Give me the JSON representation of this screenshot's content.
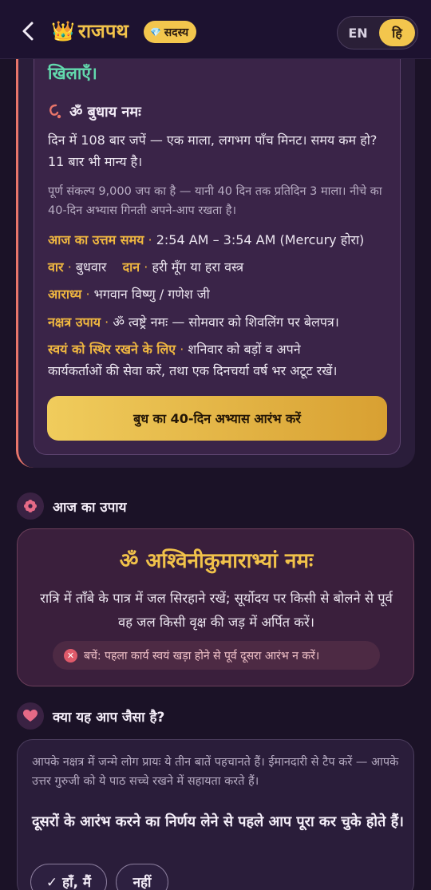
{
  "header": {
    "back_icon": "chevron-left-icon",
    "logo_icon": "crown-icon",
    "logo_glyph": "👑",
    "brand": "राजपथ",
    "badge_icon_glyph": "💎",
    "badge_label": "सदस्य",
    "lang": {
      "en": "EN",
      "hi": "हि",
      "active": "hi"
    }
  },
  "remedy_card": {
    "cut_heading": "खिलाएँ।",
    "mantra_icon": "beads-icon",
    "mantra_title": "ॐ बुधाय नमः",
    "chant_text": "दिन में 108 बार जपें — एक माला, लगभग पाँच मिनट। समय कम हो? 11 बार भी मान्य है।",
    "sankalp_text": "पूर्ण संकल्प 9,000 जप का है — यानी 40 दिन तक प्रतिदिन 3 माला। नीचे का 40-दिन अभ्यास गिनती अपने-आप रखता है।",
    "best_time_label": "आज का उत्तम समय",
    "best_time_value": "2:54 AM – 3:54 AM (Mercury होरा)",
    "day_label": "वार",
    "day_value": "बुधवार",
    "donation_label": "दान",
    "donation_value": "हरी मूँग या हरा वस्त्र",
    "deity_label": "आराध्य",
    "deity_value": "भगवान विष्णु / गणेश जी",
    "nakshatra_label": "नक्षत्र उपाय",
    "nakshatra_value": "ॐ त्वष्ट्रे नमः — सोमवार को शिवलिंग पर बेलपत्र।",
    "stability_label": "स्वयं को स्थिर रखने के लिए",
    "stability_value_line1": "शनिवार को बड़ों व अपने",
    "stability_value_line2": "कार्यकर्ताओं की सेवा करें, तथा एक दिनचर्या वर्ष भर अटूट रखें।",
    "separator": "·",
    "cta_label": "बुध का 40-दिन अभ्यास आरंभ करें"
  },
  "today_remedy": {
    "icon": "flower-icon",
    "title": "आज का उपाय",
    "mantra": "ॐ अश्विनीकुमाराभ्यां नमः",
    "text": "रात्रि में ताँबे के पात्र में जल सिरहाने रखें; सूर्योदय पर किसी से बोलने से पूर्व वह जल किसी वृक्ष की जड़ में अर्पित करें।",
    "warning_icon": "close-circle-icon",
    "warning": "बचें: पहला कार्य स्वयं खड़ा होने से पूर्व दूसरा आरंभ न करें।"
  },
  "like_you": {
    "icon": "heart-icon",
    "title": "क्या यह आप जैसा है?",
    "intro": "आपके नक्षत्र में जन्मे लोग प्रायः ये तीन बातें पहचानते हैं। ईमानदारी से टैप करें — आपके उत्तर गुरुजी को ये पाठ सच्चे रखने में सहायता करते हैं।",
    "question": "दूसरों के आरंभ करने का निर्णय लेने से पहले आप पूरा कर चुके होते हैं।",
    "yes_label": "✓ हाँ, मैं",
    "no_label": "नहीं"
  },
  "colors": {
    "accent": "#f3c64d",
    "teal": "#62d9ad",
    "label": "#f1b840",
    "bg": "#1b1227"
  }
}
